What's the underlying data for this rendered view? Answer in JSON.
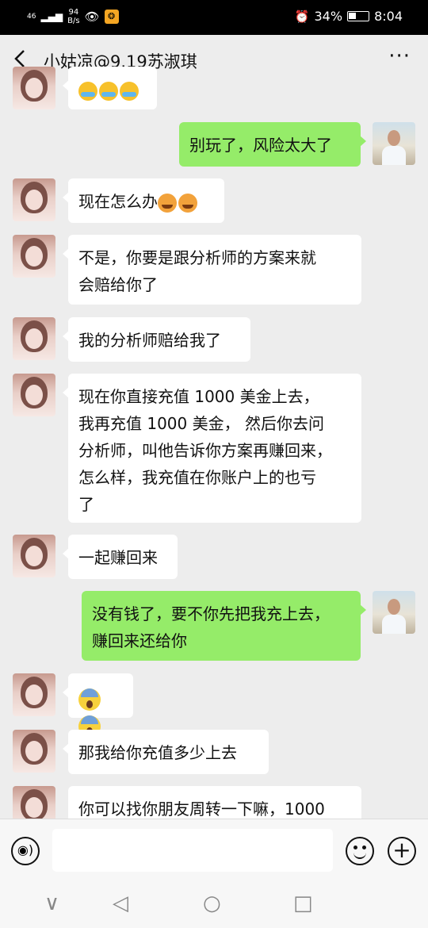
{
  "status_bar": {
    "network": "46",
    "speed_value": "94",
    "speed_unit": "B/s",
    "battery": "34%",
    "time": "8:04"
  },
  "header": {
    "title": "小姑凉@9.19苏淑琪",
    "back_icon": "chevron-left-icon",
    "more_icon": "more-dots-icon",
    "more_glyph": "···"
  },
  "messages": [
    {
      "id": "m0",
      "side": "in",
      "emojis": [
        "cry",
        "cry",
        "cry"
      ]
    },
    {
      "id": "m1",
      "side": "out",
      "text": "别玩了，风险太大了"
    },
    {
      "id": "m2",
      "side": "in",
      "text": "现在怎么办",
      "emojis": [
        "angry",
        "angry"
      ]
    },
    {
      "id": "m3",
      "side": "in",
      "lines": [
        "不是，你要是跟分析师的方案来就",
        "会赔给你了"
      ]
    },
    {
      "id": "m4",
      "side": "in",
      "text": "我的分析师赔给我了"
    },
    {
      "id": "m5",
      "side": "in",
      "lines": [
        "现在你直接充值 1000 美金上去，",
        "我再充值 1000 美金， 然后你去问",
        "分析师，叫他告诉你方案再赚回来，",
        "怎么样，我充值在你账户上的也亏",
        "了"
      ]
    },
    {
      "id": "m6",
      "side": "in",
      "text": "一起赚回来"
    },
    {
      "id": "m7",
      "side": "out",
      "lines": [
        "没有钱了，要不你先把我充上去，",
        "赚回来还给你"
      ]
    },
    {
      "id": "m8",
      "side": "in",
      "emojis": [
        "scream",
        "scream"
      ]
    },
    {
      "id": "m9",
      "side": "in",
      "text": "那我给你充值多少上去"
    },
    {
      "id": "m10",
      "side": "in",
      "text": "你可以找你朋友周转一下嘛，1000"
    }
  ],
  "input_bar": {
    "voice_icon": "voice-icon",
    "voice_glyph": "◉)",
    "emoji_icon": "emoji-icon",
    "plus_icon": "plus-icon",
    "plus_glyph": "+"
  },
  "nav_bar": {
    "icons": [
      "chevron-down-icon",
      "back-triangle-icon",
      "home-circle-icon",
      "recents-square-icon"
    ],
    "glyphs": [
      "∨",
      "◁",
      "○",
      "□"
    ]
  }
}
